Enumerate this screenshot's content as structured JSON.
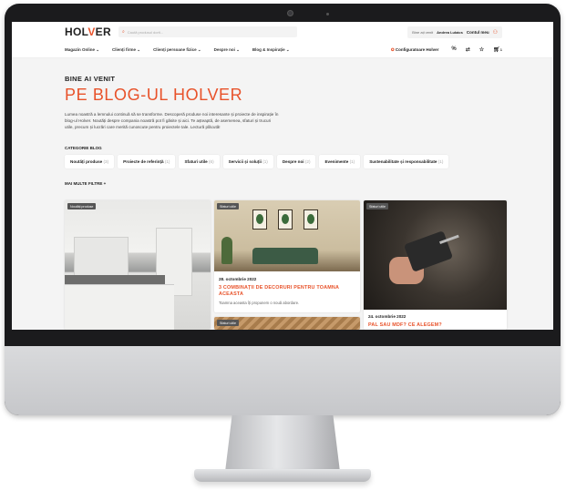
{
  "brand": {
    "logo_left": "HOL",
    "logo_v": "V",
    "logo_right": "ER",
    "accent": "#e8522a"
  },
  "search": {
    "placeholder": "Caută produsul dorit..."
  },
  "account": {
    "greeting": "Bine ați venit",
    "user_name": "Andrea Lukács",
    "my_account": "Contul meu"
  },
  "nav": {
    "items": [
      "Magazin Online ⌄",
      "Clienți firme ⌄",
      "Clienți persoane fizice ⌄",
      "Despre noi ⌄",
      "Blog & Inspirație ⌄"
    ],
    "configurator": "Configuratoare Holver",
    "cart_count": "1"
  },
  "hero": {
    "welcome": "BINE AI VENIT",
    "headline": "PE BLOG-UL HOLVER",
    "intro": "Lumea noastră a lemnului continuă să se transforme. Descoperă produse noi interesante și proiecte de inspirație în blog-ul Holver. Noutăți despre compania noastră pot fi găsite și aici. Te așteaptă, de asemenea, sfaturi și trucuri utile, precum și lucrări care merită cunoscute pentru proiectele tale. Lectură plăcută!"
  },
  "categories": {
    "label": "CATEGORIE BLOG",
    "chips": [
      {
        "label": "Noutăți produse",
        "count": "(3)"
      },
      {
        "label": "Proiecte de referință",
        "count": "(1)"
      },
      {
        "label": "Sfaturi utile",
        "count": "(6)"
      },
      {
        "label": "Servicii și soluții",
        "count": "(1)"
      },
      {
        "label": "Despre noi",
        "count": "(2)"
      },
      {
        "label": "Evenimente",
        "count": "(1)"
      },
      {
        "label": "Sustenabilitate și responsabilitate",
        "count": "(1)"
      }
    ]
  },
  "more_filters": "MAI MULTE FILTRE  +",
  "cards": [
    {
      "tag": "Noutăți produse"
    },
    {
      "tag": "Sfaturi utile",
      "date": "28. octombrie 2022",
      "title": "3 COMBINAȚII DE DECORURI PENTRU TOAMNA ACEASTA",
      "excerpt": "Toamna aceasta îți propunem o nouă abordare."
    },
    {
      "tag": "Sfaturi utile",
      "date": "24. octombrie 2022",
      "title": "PAL SAU MDF? CE ALEGEM?"
    },
    {
      "tag": "Sfaturi utile"
    }
  ]
}
